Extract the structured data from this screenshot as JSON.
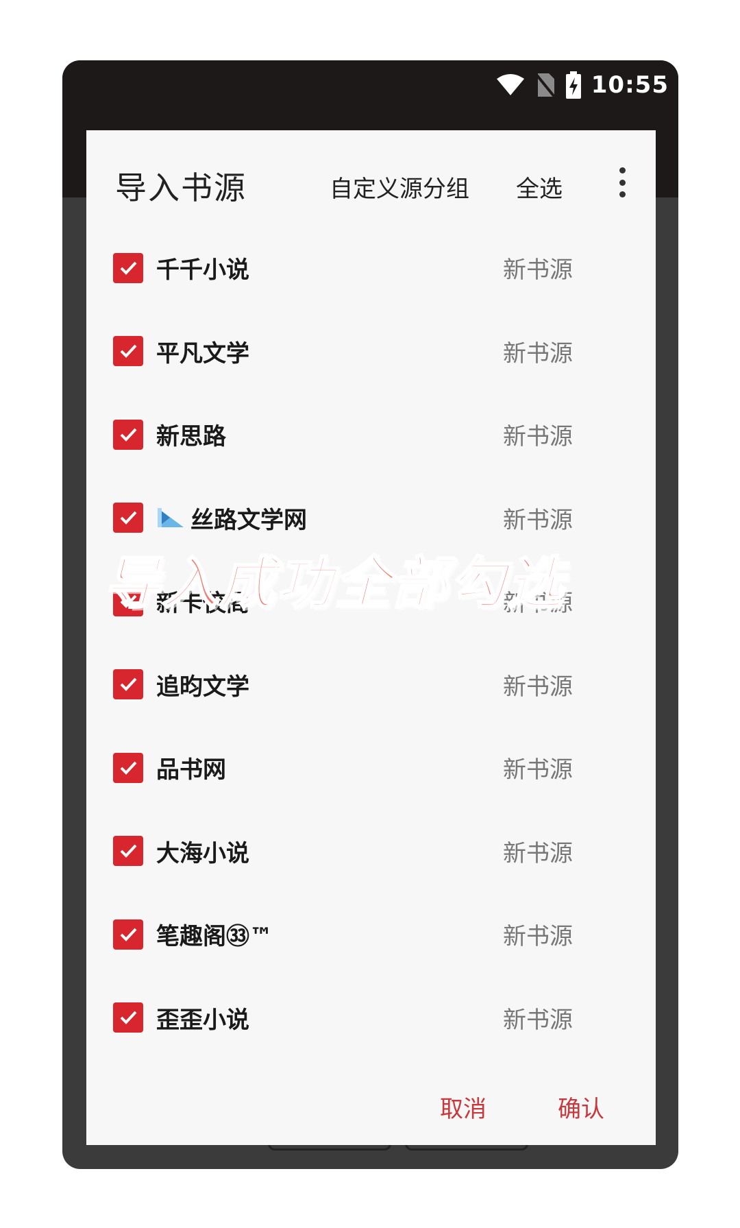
{
  "status_bar": {
    "time": "10:55",
    "icons": [
      "wifi-icon",
      "no-sim-icon",
      "battery-charging-icon"
    ]
  },
  "dialog": {
    "title": "导入书源",
    "actions": {
      "custom_group": "自定义源分组",
      "select_all": "全选",
      "more_icon": "more-vert-icon"
    },
    "items": [
      {
        "name": "千千小说",
        "group": "新书源",
        "checked": true
      },
      {
        "name": "平凡文学",
        "group": "新书源",
        "checked": true
      },
      {
        "name": "新思路",
        "group": "新书源",
        "checked": true
      },
      {
        "name": "丝路文学网",
        "group": "新书源",
        "checked": true,
        "icon": "site-image-icon"
      },
      {
        "name": "新卡佼阁",
        "group": "新书源",
        "checked": true
      },
      {
        "name": "追昀文学",
        "group": "新书源",
        "checked": true
      },
      {
        "name": "品书网",
        "group": "新书源",
        "checked": true
      },
      {
        "name": "大海小说",
        "group": "新书源",
        "checked": true
      },
      {
        "name": "笔趣阁㉝™",
        "group": "新书源",
        "checked": true
      },
      {
        "name": "歪歪小说",
        "group": "新书源",
        "checked": true
      }
    ],
    "buttons": {
      "cancel": "取消",
      "confirm": "确认"
    }
  },
  "caption": "导入成功全部勾选",
  "colors": {
    "accent": "#d7262e",
    "button_text": "#c8373b",
    "caption": "#f07a72"
  }
}
